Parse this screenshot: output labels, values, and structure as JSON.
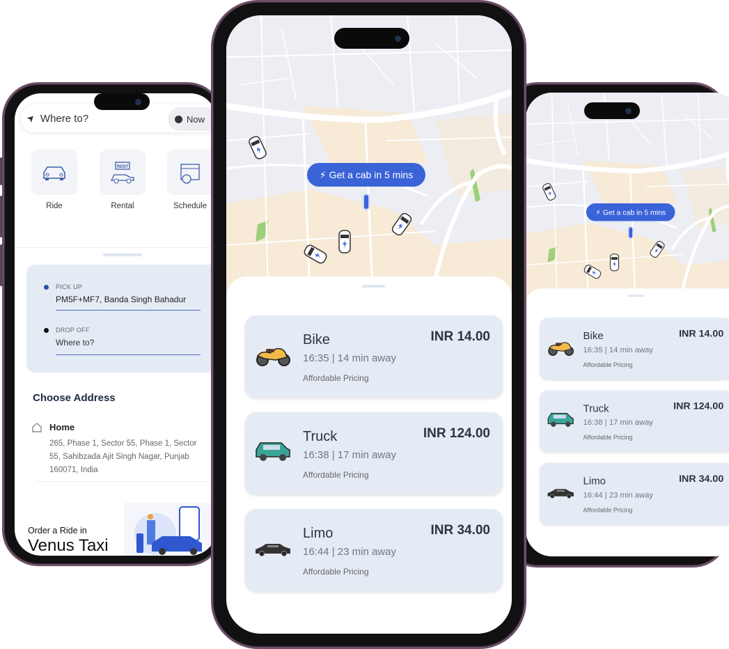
{
  "left_phone": {
    "search_placeholder": "Where to?",
    "time_option": "Now",
    "services": [
      {
        "label": "Ride",
        "icon": "car-icon"
      },
      {
        "label": "Rental",
        "icon": "rent-car-icon",
        "badge": "RENT"
      },
      {
        "label": "Schedule",
        "icon": "calendar-car-icon"
      }
    ],
    "pickup": {
      "label": "PICK UP",
      "value": "PM5F+MF7, Banda Singh Bahadur"
    },
    "dropoff": {
      "label": "DROP OFF",
      "placeholder": "Where to?"
    },
    "choose_address_title": "Choose Address",
    "saved_address": {
      "name": "Home",
      "lines": [
        "265, Phase 1, Sector 55, Phase 1, Sector",
        "55, Sahibzada Ajit Singh Nagar, Punjab",
        "160071, India"
      ]
    },
    "promo": {
      "line1": "Order a Ride in",
      "line2": "Venus Taxi"
    }
  },
  "ride_screen": {
    "map_pill": "Get a cab in 5 mins",
    "options": [
      {
        "name": "Bike",
        "time": "16:35 | 14 min away",
        "tag": "Affordable Pricing",
        "price": "INR 14.00",
        "icon": "motorcycle-icon"
      },
      {
        "name": "Truck",
        "time": "16:38 | 17 min away",
        "tag": "Affordable Pricing",
        "price": "INR 124.00",
        "icon": "teal-car-icon"
      },
      {
        "name": "Limo",
        "time": "16:44 | 23 min away",
        "tag": "Affordable Pricing",
        "price": "INR 34.00",
        "icon": "limo-icon"
      }
    ]
  },
  "colors": {
    "accent": "#3b63d8",
    "card_bg": "#e4ebf5",
    "frame": "#6b5068",
    "map_bg": "#eceef3",
    "map_area": "#f7ead6",
    "map_park": "#9ccf7a"
  }
}
